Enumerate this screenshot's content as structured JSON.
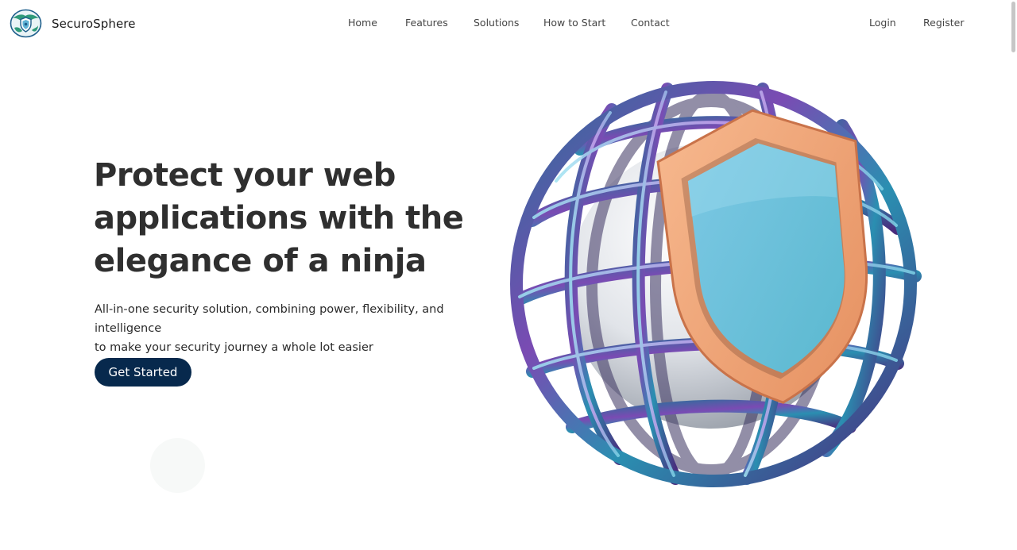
{
  "brand": {
    "name": "SecuroSphere",
    "logo_icon": "globe-shield-logo-icon"
  },
  "nav": {
    "links": [
      {
        "label": "Home"
      },
      {
        "label": "Features"
      },
      {
        "label": "Solutions"
      },
      {
        "label": "How to Start"
      },
      {
        "label": "Contact"
      }
    ],
    "auth": {
      "login": "Login",
      "register": "Register"
    }
  },
  "hero": {
    "title_line1": "Protect your web",
    "title_line2": "applications with the",
    "title_line3": "elegance of a ninja",
    "subtitle_line1": "All-in-one security solution, combining power, flexibility, and intelligence",
    "subtitle_line2": "to make your security journey a whole lot easier",
    "cta_label": "Get Started",
    "illustration": "globe-cage-with-shield-illustration"
  },
  "colors": {
    "primary": "#07294d",
    "text_dark": "#2f2f2f",
    "shield_frame": "#f2a274",
    "shield_face": "#6fc4dc",
    "cage_blue": "#1f5f8c",
    "cage_purple": "#6b3fa8",
    "globe": "#e4e7eb"
  }
}
